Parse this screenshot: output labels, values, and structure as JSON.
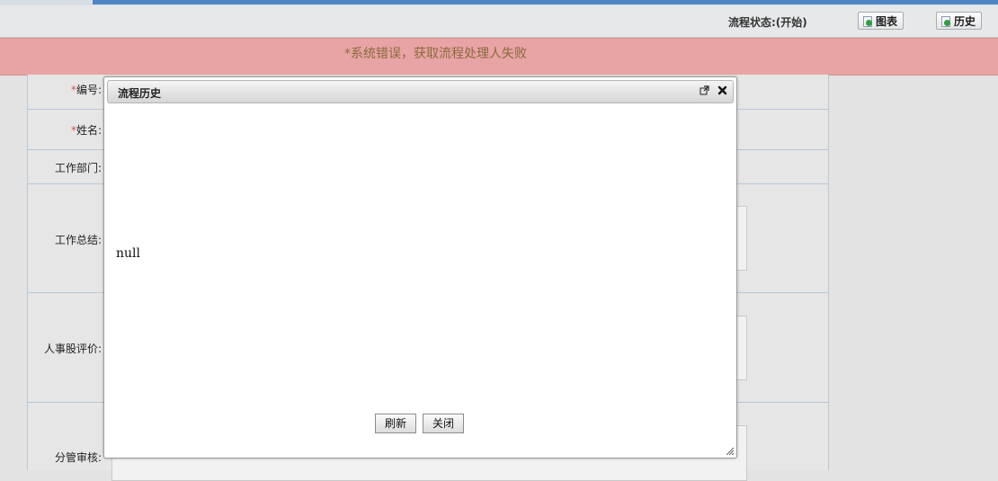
{
  "header": {
    "status": "流程状态:(开始)",
    "chart_button": "图表",
    "history_button": "历史"
  },
  "error": {
    "message": "*系统错误，获取流程处理人失败"
  },
  "form": {
    "fields": [
      {
        "required": "*",
        "label": "编号:"
      },
      {
        "required": "*",
        "label": "姓名:"
      },
      {
        "required": "",
        "label": "工作部门:"
      },
      {
        "required": "",
        "label": "工作总结:"
      },
      {
        "required": "",
        "label": "人事股评价:"
      },
      {
        "required": "",
        "label": "分管审核:"
      }
    ]
  },
  "dialog": {
    "title": "流程历史",
    "content": "null",
    "refresh_button": "刷新",
    "close_button": "关闭",
    "icons": [
      "maximize-icon",
      "close-icon",
      "resize-grip-icon"
    ]
  }
}
